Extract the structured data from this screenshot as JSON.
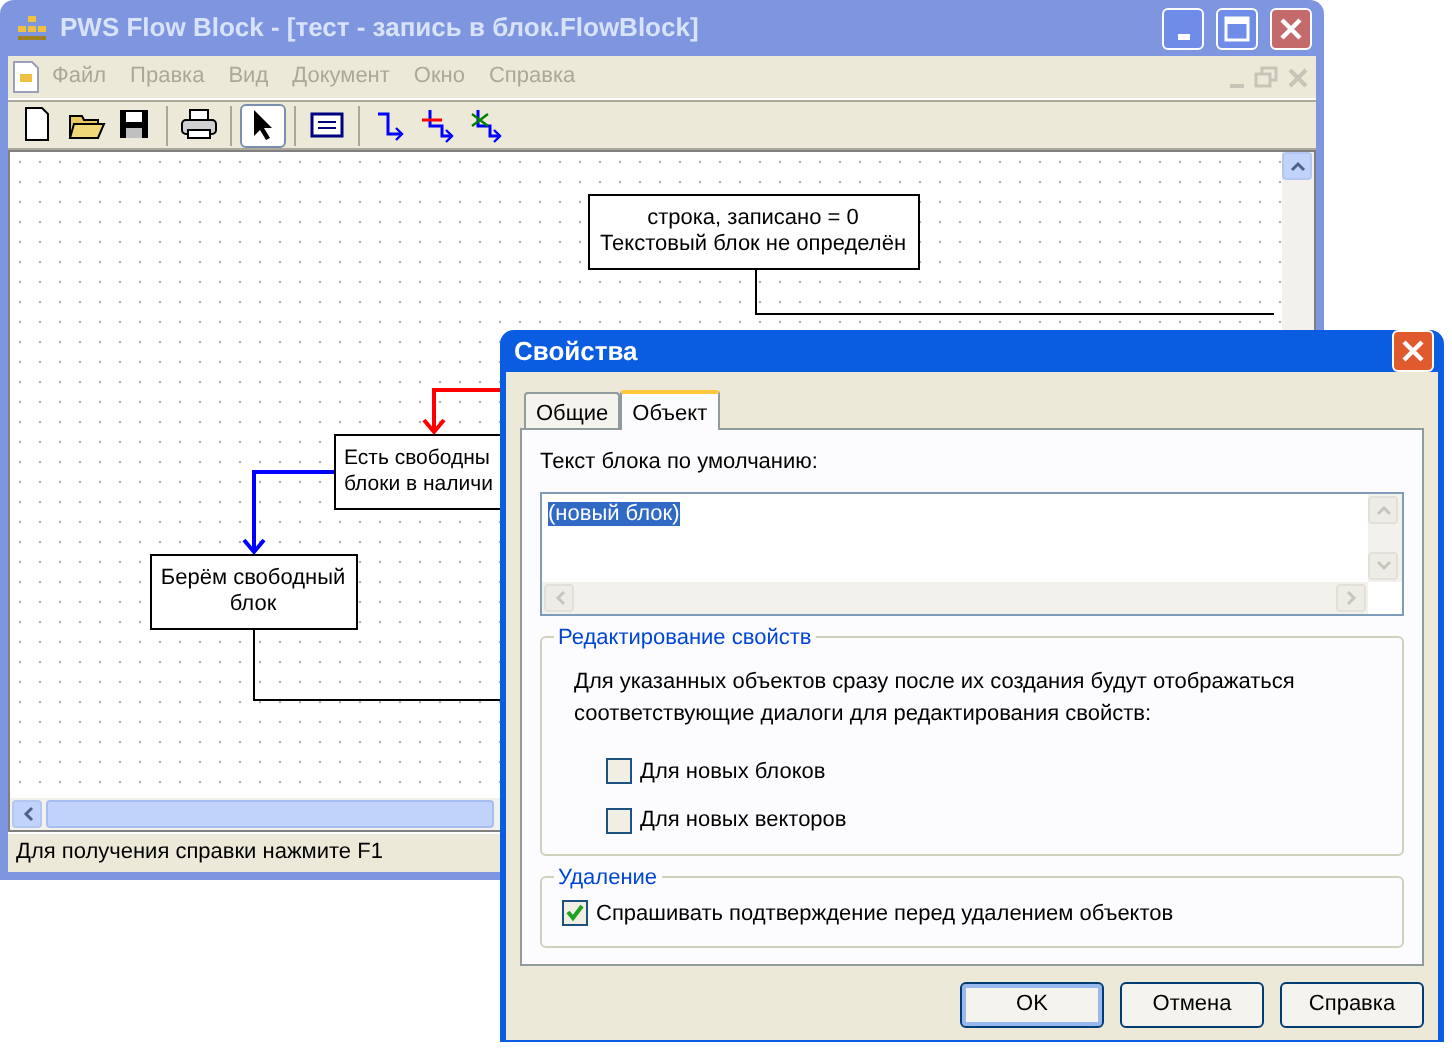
{
  "main_window": {
    "title": "PWS Flow Block - [тест - запись в блок.FlowBlock]",
    "active": false,
    "menu": [
      {
        "label": "Файл",
        "disabled": true
      },
      {
        "label": "Правка",
        "disabled": true
      },
      {
        "label": "Вид",
        "disabled": true
      },
      {
        "label": "Документ",
        "disabled": true
      },
      {
        "label": "Окно",
        "disabled": true
      },
      {
        "label": "Справка",
        "disabled": true
      }
    ],
    "toolbar": [
      {
        "kind": "new",
        "selected": false
      },
      {
        "kind": "open",
        "selected": false
      },
      {
        "kind": "save",
        "selected": false
      },
      {
        "kind": "print",
        "selected": false
      },
      {
        "kind": "pointer",
        "selected": true
      },
      {
        "kind": "block",
        "selected": false
      },
      {
        "kind": "connector",
        "selected": false
      },
      {
        "kind": "connector-add",
        "selected": false
      },
      {
        "kind": "connector-edit",
        "selected": false
      }
    ],
    "diagram": {
      "blocks": [
        {
          "lines": [
            "строка, записано = 0",
            "Текстовый блок не определён"
          ]
        },
        {
          "lines": [
            "Есть свободны",
            "блоки в наличи"
          ]
        },
        {
          "lines": [
            "Берём свободный",
            "блок"
          ]
        }
      ],
      "connectors": [
        {
          "color": "#000000"
        },
        {
          "color": "#ff0000"
        },
        {
          "color": "#0000ff"
        },
        {
          "color": "#000000"
        }
      ]
    },
    "status_bar": "Для получения справки нажмите F1"
  },
  "dialog": {
    "title": "Свойства",
    "tabs": [
      {
        "label": "Общие",
        "selected": false
      },
      {
        "label": "Объект",
        "selected": true
      }
    ],
    "default_text_label": "Текст блока по умолчанию:",
    "default_text": {
      "value": "(новый блок)",
      "value_selected": true
    },
    "editing_group": {
      "title": "Редактирование свойств",
      "description": "Для указанных объектов сразу после их создания будут отображаться соответствующие диалоги для редактирования свойств:",
      "checkboxes": [
        {
          "label": "Для новых блоков",
          "checked": false
        },
        {
          "label": "Для новых векторов",
          "checked": false
        }
      ]
    },
    "deletion_group": {
      "title": "Удаление",
      "checkboxes": [
        {
          "label": "Спрашивать подтверждение перед удалением объектов",
          "checked": true
        }
      ]
    },
    "buttons": [
      {
        "label": "OK",
        "default": true
      },
      {
        "label": "Отмена",
        "default": false
      },
      {
        "label": "Справка",
        "default": false
      }
    ]
  }
}
